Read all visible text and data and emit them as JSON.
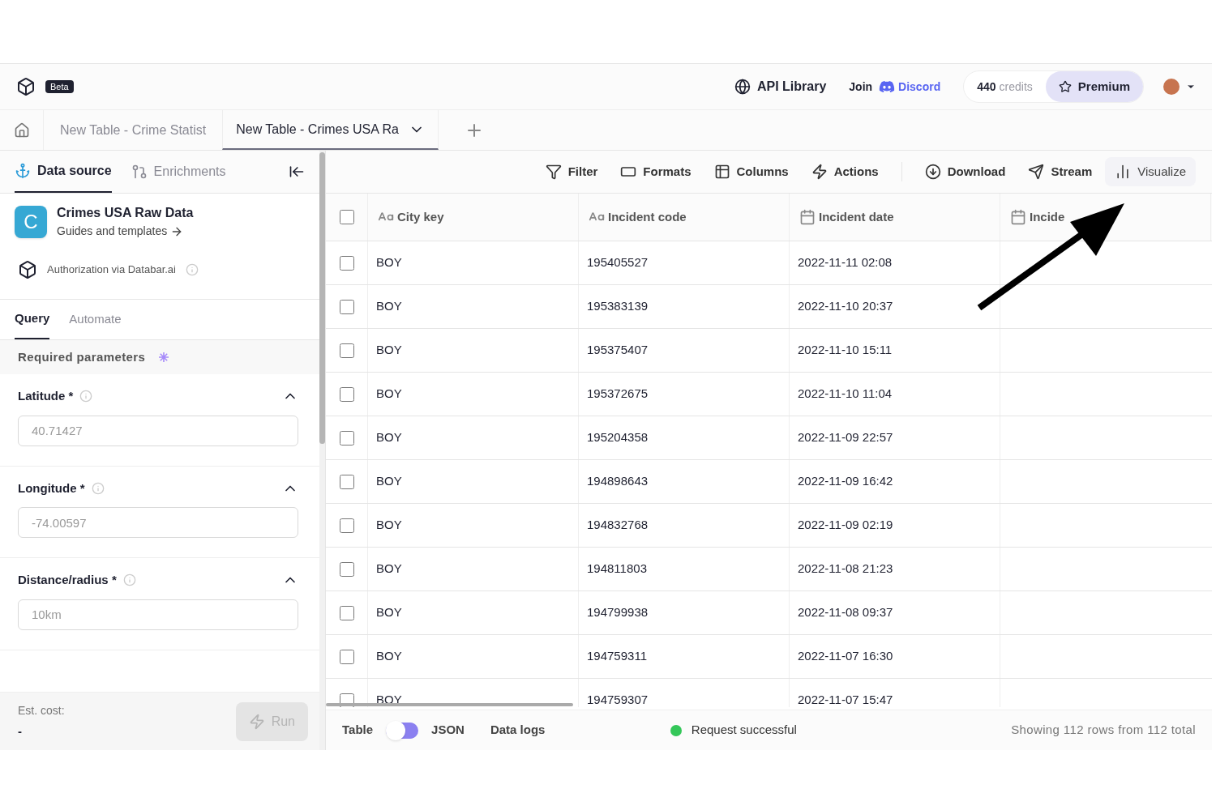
{
  "header": {
    "badge": "Beta",
    "api_library": "API Library",
    "join": "Join",
    "discord": "Discord",
    "credits_count": "440",
    "credits_label": "credits",
    "premium": "Premium"
  },
  "doc_tabs": [
    {
      "label": "New Table - Crime Statist",
      "selected": false
    },
    {
      "label": "New Table - Crimes USA Ra",
      "selected": true
    }
  ],
  "left_panel": {
    "tabs": [
      {
        "label": "Data source",
        "kind": "anchor",
        "selected": true
      },
      {
        "label": "Enrichments",
        "kind": "branch",
        "selected": false
      }
    ],
    "source": {
      "initial": "C",
      "title": "Crimes USA Raw Data",
      "link": "Guides and templates"
    },
    "auth": "Authorization via Databar.ai",
    "query_tabs": [
      {
        "label": "Query",
        "selected": true
      },
      {
        "label": "Automate",
        "selected": false
      }
    ],
    "section": "Required parameters",
    "params": [
      {
        "label": "Latitude *",
        "placeholder": "40.71427",
        "expanded": true
      },
      {
        "label": "Longitude *",
        "placeholder": "-74.00597",
        "expanded": true
      },
      {
        "label": "Distance/radius *",
        "placeholder": "10km",
        "expanded": true
      }
    ],
    "est_cost_label": "Est. cost:",
    "est_cost": "-",
    "run": {
      "label": "Run",
      "disabled": true
    }
  },
  "toolbar": [
    {
      "label": "Filter",
      "kind": "filter"
    },
    {
      "label": "Formats",
      "kind": "formats"
    },
    {
      "label": "Columns",
      "kind": "columns"
    },
    {
      "label": "Actions",
      "kind": "actions"
    },
    {
      "label": "Download",
      "kind": "download"
    },
    {
      "label": "Stream",
      "kind": "stream"
    },
    {
      "label": "Visualize",
      "kind": "visualize"
    }
  ],
  "table": {
    "all_checked": false,
    "columns": [
      {
        "label": "City key",
        "kind": "text"
      },
      {
        "label": "Incident code",
        "kind": "text"
      },
      {
        "label": "Incident date",
        "kind": "date"
      },
      {
        "label": "Incide",
        "kind": "date"
      }
    ],
    "rows": [
      {
        "checked": false,
        "cells": [
          "BOY",
          "195405527",
          "2022-11-11 02:08"
        ]
      },
      {
        "checked": false,
        "cells": [
          "BOY",
          "195383139",
          "2022-11-10 20:37"
        ]
      },
      {
        "checked": false,
        "cells": [
          "BOY",
          "195375407",
          "2022-11-10 15:11"
        ]
      },
      {
        "checked": false,
        "cells": [
          "BOY",
          "195372675",
          "2022-11-10 11:04"
        ]
      },
      {
        "checked": false,
        "cells": [
          "BOY",
          "195204358",
          "2022-11-09 22:57"
        ]
      },
      {
        "checked": false,
        "cells": [
          "BOY",
          "194898643",
          "2022-11-09 16:42"
        ]
      },
      {
        "checked": false,
        "cells": [
          "BOY",
          "194832768",
          "2022-11-09 02:19"
        ]
      },
      {
        "checked": false,
        "cells": [
          "BOY",
          "194811803",
          "2022-11-08 21:23"
        ]
      },
      {
        "checked": false,
        "cells": [
          "BOY",
          "194799938",
          "2022-11-08 09:37"
        ]
      },
      {
        "checked": false,
        "cells": [
          "BOY",
          "194759311",
          "2022-11-07 16:30"
        ]
      },
      {
        "checked": false,
        "cells": [
          "BOY",
          "194759307",
          "2022-11-07 15:47"
        ]
      }
    ]
  },
  "footer": {
    "view_left": "Table",
    "view_right": "JSON",
    "json_on": false,
    "logs": "Data logs",
    "status": {
      "kind": "success",
      "text": "Request successful"
    },
    "summary": "Showing 112 rows from 112 total"
  }
}
